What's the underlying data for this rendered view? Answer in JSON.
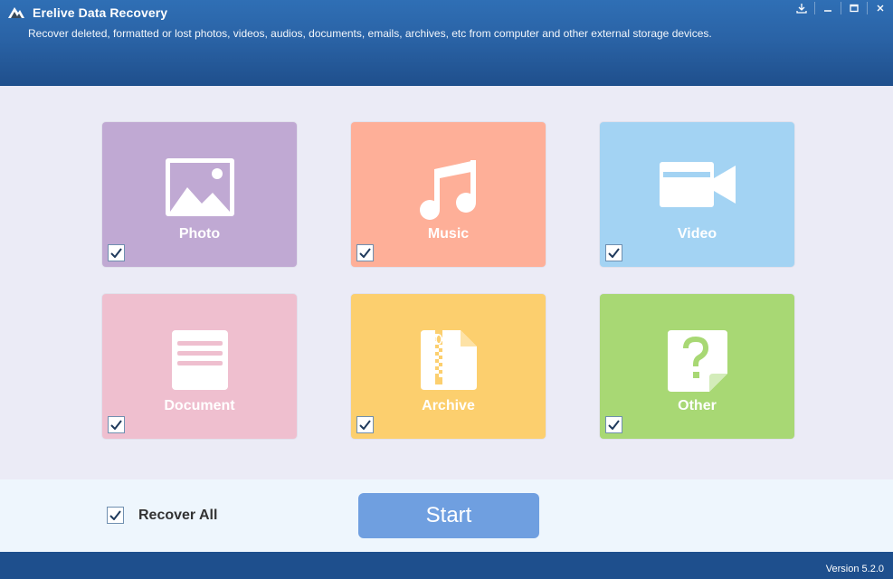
{
  "window": {
    "title": "Erelive Data Recovery",
    "subtitle": "Recover deleted, formatted or lost photos, videos, audios, documents, emails, archives, etc from computer and other external storage devices.",
    "controls": [
      "download-icon",
      "minimize-icon",
      "maximize-icon",
      "close-icon"
    ]
  },
  "categories": [
    {
      "label": "Photo",
      "icon": "photo-icon",
      "color": "#c0a9d3",
      "checked": true
    },
    {
      "label": "Music",
      "icon": "music-icon",
      "color": "#feaf98",
      "checked": true
    },
    {
      "label": "Video",
      "icon": "video-icon",
      "color": "#a3d3f3",
      "checked": true
    },
    {
      "label": "Document",
      "icon": "document-icon",
      "color": "#efbfcf",
      "checked": true
    },
    {
      "label": "Archive",
      "icon": "archive-icon",
      "color": "#fccf6e",
      "checked": true
    },
    {
      "label": "Other",
      "icon": "other-icon",
      "color": "#a8d874",
      "checked": true
    }
  ],
  "bottom": {
    "recover_all_label": "Recover All",
    "recover_all_checked": true,
    "start_label": "Start"
  },
  "footer": {
    "version": "Version 5.2.0"
  }
}
